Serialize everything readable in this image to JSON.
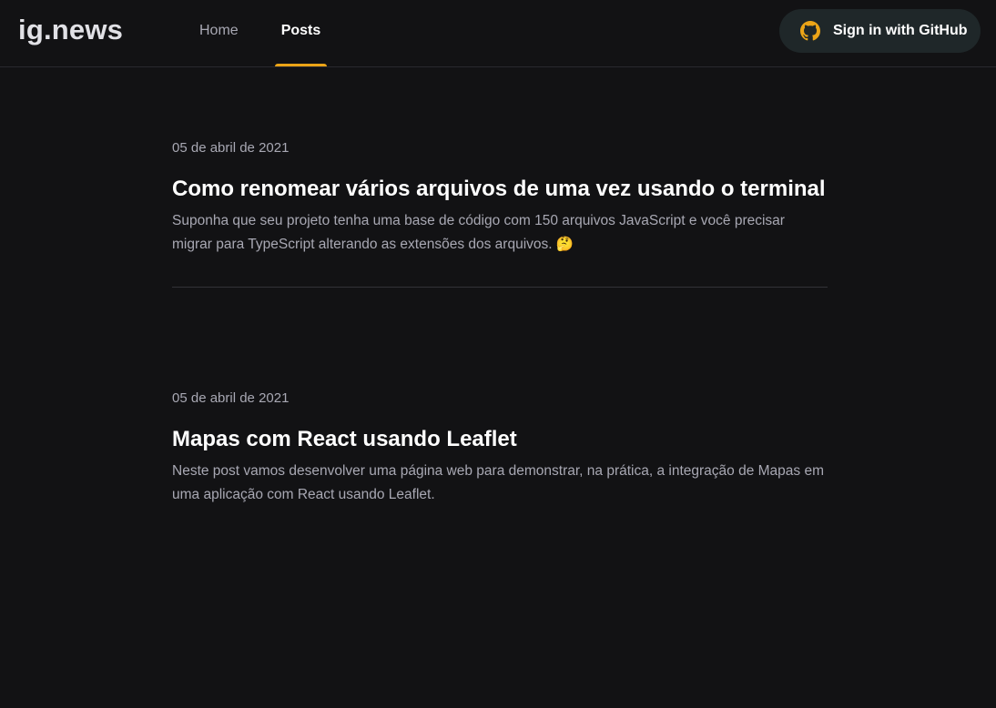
{
  "header": {
    "logo": "ig.news",
    "nav": [
      {
        "label": "Home",
        "active": false
      },
      {
        "label": "Posts",
        "active": true
      }
    ],
    "signin_label": "Sign in with GitHub",
    "signin_icon": "github-icon"
  },
  "colors": {
    "background": "#121214",
    "accent": "#eba417",
    "button_bg": "#1f2729"
  },
  "posts": [
    {
      "date": "05 de abril de 2021",
      "title": "Como renomear vários arquivos de uma vez usando o terminal",
      "excerpt": "Suponha que seu projeto tenha uma base de código com 150 arquivos JavaScript e você precisar migrar para TypeScript alterando as extensões dos arquivos. 🤔"
    },
    {
      "date": "05 de abril de 2021",
      "title": "Mapas com React usando Leaflet",
      "excerpt": "Neste post vamos desenvolver uma página web para demonstrar, na prática, a integração de Mapas em uma aplicação com React usando Leaflet."
    }
  ]
}
